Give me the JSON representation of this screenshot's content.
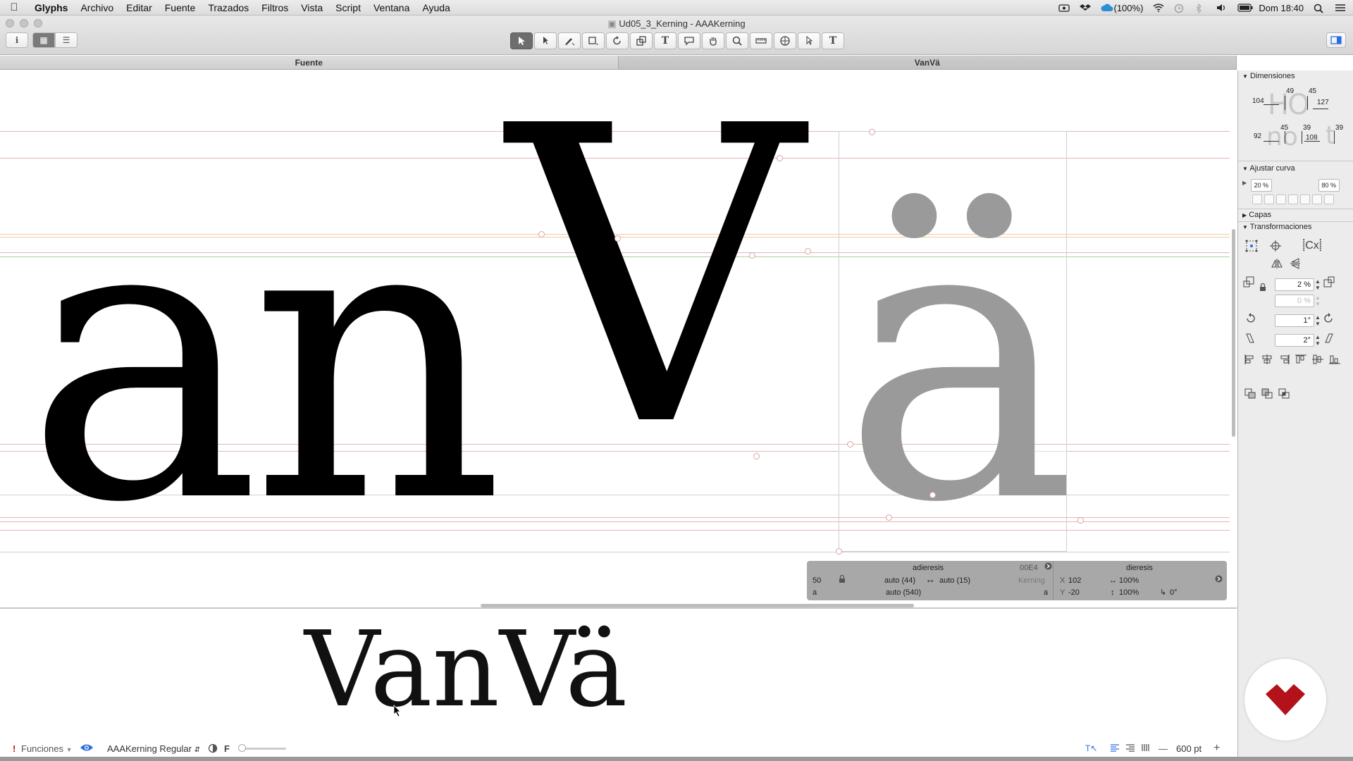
{
  "menubar": {
    "apple": "",
    "items": [
      "Glyphs",
      "Archivo",
      "Editar",
      "Fuente",
      "Trazados",
      "Filtros",
      "Vista",
      "Script",
      "Ventana",
      "Ayuda"
    ],
    "battery": "(100%)",
    "clock": "Dom 18:40"
  },
  "window": {
    "title": "Ud05_3_Kerning - AAAKerning"
  },
  "tabs": [
    "Fuente",
    "VanVä"
  ],
  "canvas": {
    "glyphs": [
      "a",
      "n",
      "V",
      "ä"
    ]
  },
  "infobox": {
    "left_glyph": "adieresis",
    "unicode": "00E4",
    "width": "50",
    "left_sb": "auto (44)",
    "right_sb": "auto (15)",
    "kerning_label": "Kerning",
    "row2_left": "a",
    "row2_center": "auto (540)",
    "row2_right": "a",
    "component": "dieresis",
    "x_label": "X",
    "x_value": "102",
    "scale_x": "100%",
    "y_label": "Y",
    "y_value": "-20",
    "scale_y": "100%",
    "angle": "0°"
  },
  "preview": {
    "text": "VanVä"
  },
  "bottombar": {
    "features": "Funciones",
    "master": "AAAKerning Regular",
    "f_label": "F",
    "size": "600 pt"
  },
  "panel": {
    "dimensions_title": "Dimensiones",
    "dim_ho": "HO",
    "dim_no": "no",
    "dim_t": "t",
    "dim_vals_top": [
      "104",
      "49",
      "45",
      "127"
    ],
    "dim_vals_bottom": [
      "92",
      "45",
      "39",
      "108",
      "39"
    ],
    "curve_title": "Ajustar curva",
    "curve_min": "20 %",
    "curve_max": "80 %",
    "layers_title": "Capas",
    "transform_title": "Transformaciones",
    "scale_value": "2 %",
    "scale_value2": "0 %",
    "rotate_value": "1°",
    "slant_value": "2°"
  },
  "colors": {
    "accent": "#2b6de0",
    "metric_red": "#e8b4b4",
    "metric_green": "#a8d0a8",
    "component_gray": "#9a9a9a",
    "brand_red": "#b3121a"
  }
}
